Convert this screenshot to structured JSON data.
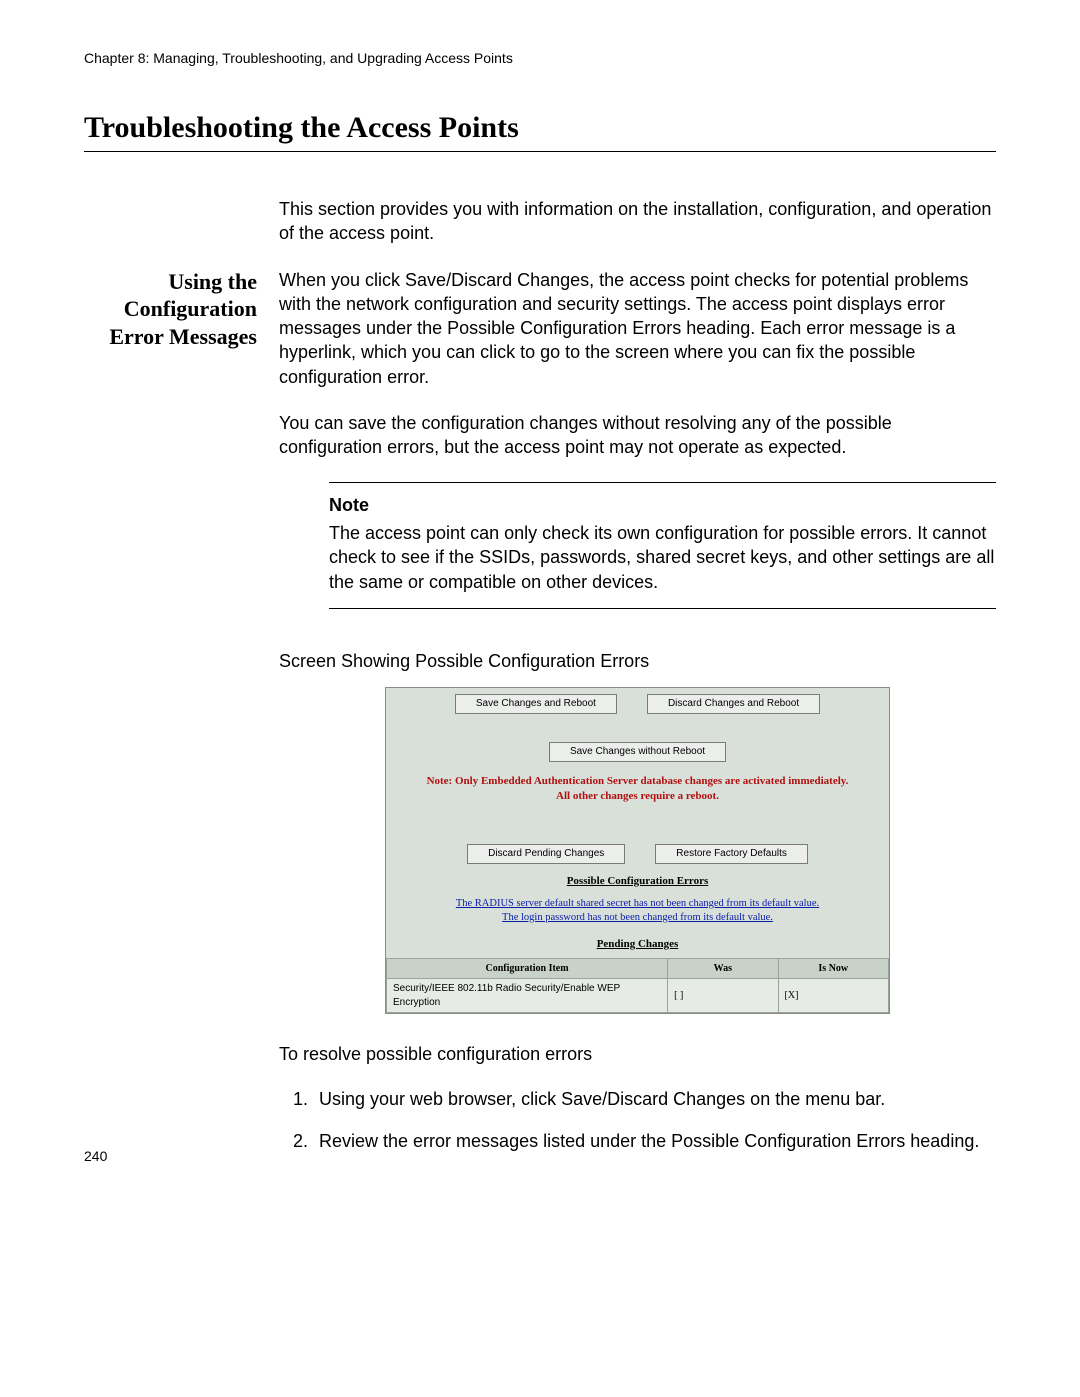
{
  "chapter_line": "Chapter 8: Managing, Troubleshooting, and Upgrading Access Points",
  "section_title": "Troubleshooting the Access Points",
  "intro_paragraph": "This section provides you with information on the installation, configuration, and operation of the access point.",
  "subhead_l1": "Using the",
  "subhead_l2": "Configuration",
  "subhead_l3": "Error Messages",
  "body_p1": "When you click Save/Discard Changes, the access point checks for potential problems with the network configuration and security settings. The access point displays error messages under the Possible Configuration Errors heading. Each error message is a hyperlink, which you can click to go to the screen where you can fix the possible configuration error.",
  "body_p2": "You can save the configuration changes without resolving any of the possible configuration errors, but the access point may not operate as expected.",
  "note_label": "Note",
  "note_body": "The access point can only check its own configuration for possible errors. It cannot check to see if the SSIDs, passwords, shared secret keys, and other settings are all the same or compatible on other devices.",
  "figure_caption": "Screen Showing Possible Configuration Errors",
  "shot": {
    "btn_save_reboot": "Save Changes and Reboot",
    "btn_discard_reboot": "Discard Changes and Reboot",
    "btn_save_no_reboot": "Save Changes without Reboot",
    "note_line1": "Note: Only Embedded Authentication Server database changes are activated immediately.",
    "note_line2": "All other changes require a reboot.",
    "btn_discard_pending": "Discard Pending Changes",
    "btn_restore_defaults": "Restore Factory Defaults",
    "sect_errors": "Possible Configuration Errors",
    "err1": "The RADIUS server default shared secret has not been changed from its default value.",
    "err2": "The login password has not been changed from its default value.",
    "sect_pending": "Pending Changes",
    "th_item": "Configuration Item",
    "th_was": "Was",
    "th_now": "Is Now",
    "td_item": "Security/IEEE 802.11b Radio Security/Enable WEP Encryption",
    "td_was": "[ ]",
    "td_now": "[X]"
  },
  "resolve_intro": "To resolve possible configuration errors",
  "step1": "Using your web browser, click Save/Discard Changes on the menu bar.",
  "step2": "Review the error messages listed under the Possible Configuration Errors heading.",
  "page_number": "240"
}
